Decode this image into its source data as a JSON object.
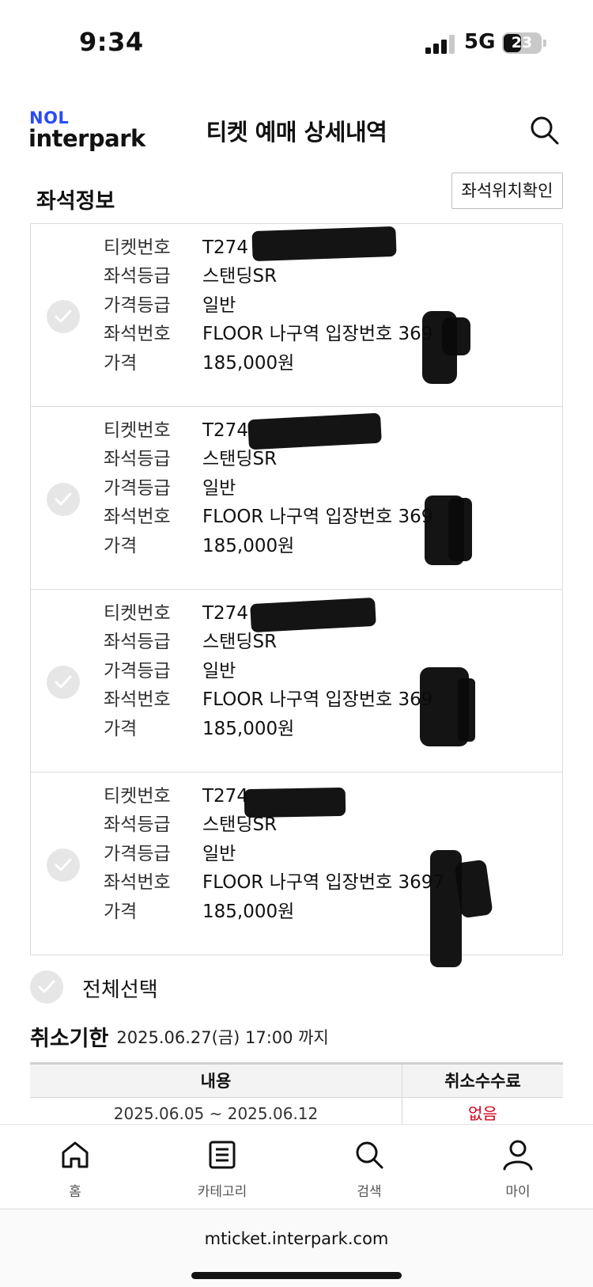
{
  "status_bar": {
    "time": "9:34",
    "network": "5G",
    "battery": "23"
  },
  "header": {
    "logo_top": "NOL",
    "logo_bottom": "interpark",
    "title": "티켓 예매 상세내역",
    "search_icon": "search-icon"
  },
  "seat_section": {
    "title": "좌석정보",
    "location_button": "좌석위치확인",
    "labels": {
      "ticket_no": "티켓번호",
      "seat_grade": "좌석등급",
      "price_grade": "가격등급",
      "seat_no": "좌석번호",
      "price": "가격"
    },
    "tickets": [
      {
        "ticket_no": "T274",
        "seat_grade": "스탠딩SR",
        "price_grade": "일반",
        "seat_no": "FLOOR 나구역 입장번호 369",
        "price": "185,000원"
      },
      {
        "ticket_no": "T274",
        "seat_grade": "스탠딩SR",
        "price_grade": "일반",
        "seat_no": "FLOOR 나구역 입장번호 369",
        "price": "185,000원"
      },
      {
        "ticket_no": "T274",
        "seat_grade": "스탠딩SR",
        "price_grade": "일반",
        "seat_no": "FLOOR 나구역 입장번호 369",
        "price": "185,000원"
      },
      {
        "ticket_no": "T274",
        "seat_grade": "스탠딩SR",
        "price_grade": "일반",
        "seat_no": "FLOOR 나구역 입장번호 3697",
        "price": "185,000원"
      }
    ]
  },
  "select_all": "전체선택",
  "cancel_deadline": {
    "label": "취소기한",
    "value": "2025.06.27(금) 17:00 까지"
  },
  "fee_table": {
    "headers": [
      "내용",
      "취소수수료"
    ],
    "rows": [
      {
        "period": "2025.06.05 ~ 2025.06.12",
        "fee": "없음"
      }
    ]
  },
  "bottom_nav": {
    "items": [
      {
        "label": "홈",
        "icon": "home-icon"
      },
      {
        "label": "카테고리",
        "icon": "category-icon"
      },
      {
        "label": "검색",
        "icon": "search-icon"
      },
      {
        "label": "마이",
        "icon": "user-icon"
      }
    ]
  },
  "browser": {
    "url": "mticket.interpark.com"
  },
  "colors": {
    "brand_blue": "#2a4cf6",
    "fee_red": "#d0021b",
    "check_gray": "#e6e6e6"
  }
}
